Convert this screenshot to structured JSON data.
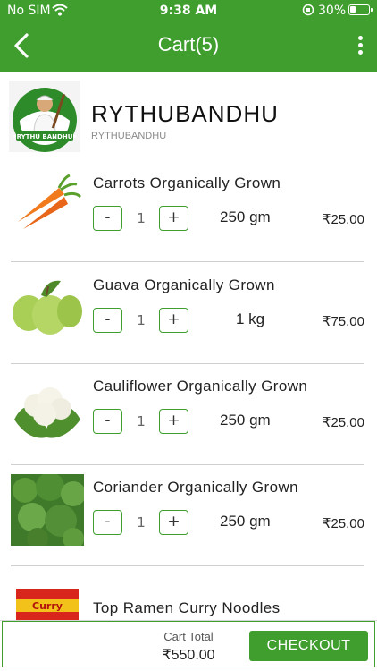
{
  "status_bar": {
    "carrier": "No SIM",
    "time": "9:38 AM",
    "battery": "30%",
    "battery_level": 0.3
  },
  "nav": {
    "title": "Cart(5)",
    "back_icon": "chevron-left-icon",
    "more_icon": "more-vertical-icon"
  },
  "store": {
    "name": "RYTHUBANDHU",
    "subtitle": "RYTHUBANDHU",
    "logo_text": "•RYTHU BANDHU•"
  },
  "items": [
    {
      "name": "Carrots Organically Grown",
      "qty": "1",
      "unit": "250 gm",
      "price": "₹25.00",
      "minus": "-",
      "plus": "+"
    },
    {
      "name": "Guava Organically Grown",
      "qty": "1",
      "unit": "1 kg",
      "price": "₹75.00",
      "minus": "-",
      "plus": "+"
    },
    {
      "name": "Cauliflower Organically Grown",
      "qty": "1",
      "unit": "250 gm",
      "price": "₹25.00",
      "minus": "-",
      "plus": "+"
    },
    {
      "name": "Coriander Organically Grown",
      "qty": "1",
      "unit": "250 gm",
      "price": "₹25.00",
      "minus": "-",
      "plus": "+"
    },
    {
      "name": "Top Ramen Curry Noodles",
      "qty": "",
      "unit": "",
      "price": "",
      "minus": "",
      "plus": "",
      "pack_text": "Curry"
    }
  ],
  "footer": {
    "total_label": "Cart Total",
    "total_value": "₹550.00",
    "checkout_label": "CHECKOUT"
  },
  "colors": {
    "brand_green": "#3f9e2e"
  }
}
